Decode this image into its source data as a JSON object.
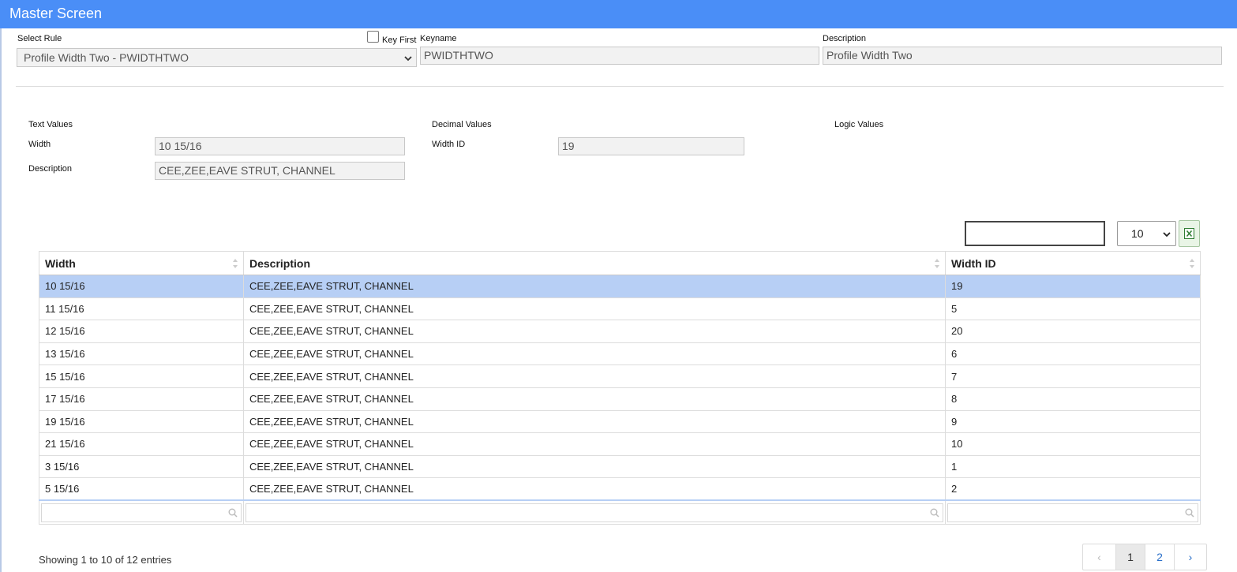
{
  "window": {
    "title": "Master Screen"
  },
  "header": {
    "select_rule_label": "Select Rule",
    "select_rule_value": "Profile Width Two - PWIDTHTWO",
    "key_first_label": "Key First",
    "key_first_checked": false,
    "keyname_label": "Keyname",
    "keyname_value": "PWIDTHTWO",
    "description_label": "Description",
    "description_value": "Profile Width Two"
  },
  "values": {
    "text_values_label": "Text Values",
    "decimal_values_label": "Decimal Values",
    "logic_values_label": "Logic Values",
    "width_label": "Width",
    "width_value": "10 15/16",
    "description_label": "Description",
    "description_value": "CEE,ZEE,EAVE STRUT, CHANNEL",
    "width_id_label": "Width ID",
    "width_id_value": "19"
  },
  "table": {
    "search_value": "",
    "page_length": "10",
    "columns": [
      "Width",
      "Description",
      "Width ID"
    ],
    "rows": [
      [
        "10 15/16",
        "CEE,ZEE,EAVE STRUT, CHANNEL",
        "19"
      ],
      [
        "11 15/16",
        "CEE,ZEE,EAVE STRUT, CHANNEL",
        "5"
      ],
      [
        "12 15/16",
        "CEE,ZEE,EAVE STRUT, CHANNEL",
        "20"
      ],
      [
        "13 15/16",
        "CEE,ZEE,EAVE STRUT, CHANNEL",
        "6"
      ],
      [
        "15 15/16",
        "CEE,ZEE,EAVE STRUT, CHANNEL",
        "7"
      ],
      [
        "17 15/16",
        "CEE,ZEE,EAVE STRUT, CHANNEL",
        "8"
      ],
      [
        "19 15/16",
        "CEE,ZEE,EAVE STRUT, CHANNEL",
        "9"
      ],
      [
        "21 15/16",
        "CEE,ZEE,EAVE STRUT, CHANNEL",
        "10"
      ],
      [
        "3 15/16",
        "CEE,ZEE,EAVE STRUT, CHANNEL",
        "1"
      ],
      [
        "5 15/16",
        "CEE,ZEE,EAVE STRUT, CHANNEL",
        "2"
      ]
    ],
    "selected_row": 0,
    "info": "Showing 1 to 10 of 12 entries",
    "pagination": {
      "prev": "‹",
      "pages": [
        "1",
        "2"
      ],
      "active_page": "1",
      "next": "›"
    }
  },
  "colors": {
    "titlebar": "#4a8ef7",
    "selected_row": "#b7cff5",
    "link": "#2a6fc9",
    "excel_icon": "#2e7d32"
  },
  "icons": {
    "excel_export": "excel-file-icon",
    "filter_search": "search-icon",
    "sort": "sort-arrows-icon",
    "dropdown": "chevron-down-icon"
  }
}
